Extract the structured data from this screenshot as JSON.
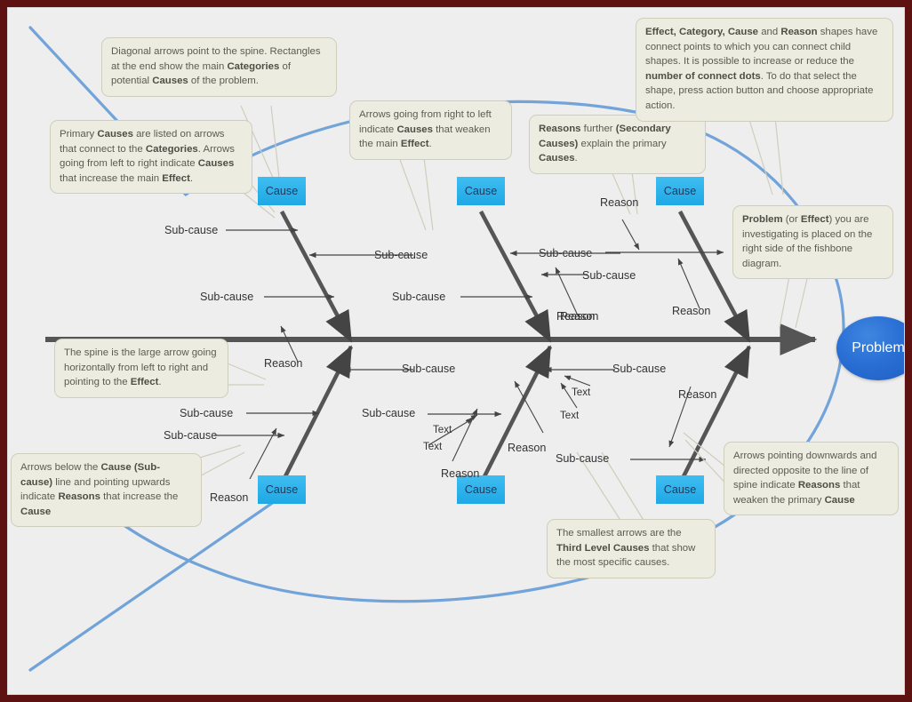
{
  "diagram": {
    "type": "fishbone-ishikawa",
    "problem_label": "Problem",
    "category_label": "Cause",
    "categories": [
      {
        "id": "cat-top-left",
        "label": "Cause"
      },
      {
        "id": "cat-top-middle",
        "label": "Cause"
      },
      {
        "id": "cat-top-right",
        "label": "Cause"
      },
      {
        "id": "cat-bottom-left",
        "label": "Cause"
      },
      {
        "id": "cat-bottom-middle",
        "label": "Cause"
      },
      {
        "id": "cat-bottom-right",
        "label": "Cause"
      }
    ],
    "labels": [
      {
        "id": "l1",
        "text": "Sub-cause"
      },
      {
        "id": "l2",
        "text": "Sub-cause"
      },
      {
        "id": "l3",
        "text": "Sub-cause"
      },
      {
        "id": "l4",
        "text": "Sub-cause"
      },
      {
        "id": "l5",
        "text": "Reason"
      },
      {
        "id": "l6",
        "text": "Sub-cause"
      },
      {
        "id": "l7",
        "text": "Sub-cause"
      },
      {
        "id": "l8",
        "text": "Reason"
      },
      {
        "id": "l9",
        "text": "Sub-cause"
      },
      {
        "id": "l10",
        "text": "Reason"
      },
      {
        "id": "l11",
        "text": "Reason"
      },
      {
        "id": "l12",
        "text": "Sub-cause"
      },
      {
        "id": "l13",
        "text": "Sub-cause"
      },
      {
        "id": "l14",
        "text": "Sub-cause"
      },
      {
        "id": "l15",
        "text": "Sub-cause"
      },
      {
        "id": "l16",
        "text": "Reason"
      },
      {
        "id": "l17",
        "text": "Text"
      },
      {
        "id": "l18",
        "text": "Text"
      },
      {
        "id": "l19",
        "text": "Text"
      },
      {
        "id": "l20",
        "text": "Text"
      },
      {
        "id": "l21",
        "text": "Reason"
      },
      {
        "id": "l22",
        "text": "Reason"
      },
      {
        "id": "l23",
        "text": "Reason"
      },
      {
        "id": "l24",
        "text": "Reason"
      },
      {
        "id": "l25",
        "text": "Sub-cause"
      },
      {
        "id": "l26",
        "text": "Reason"
      }
    ]
  },
  "notes": {
    "diagonal_arrows": {
      "id": "note-diagonal-arrows",
      "parts": [
        {
          "t": "Diagonal arrows point to the spine. Rectangles at the end show the main "
        },
        {
          "t": "Categories",
          "b": true
        },
        {
          "t": " of potential "
        },
        {
          "t": "Causes",
          "b": true
        },
        {
          "t": " of the problem."
        }
      ]
    },
    "primary_causes": {
      "id": "note-primary-causes",
      "parts": [
        {
          "t": "Primary "
        },
        {
          "t": "Causes",
          "b": true
        },
        {
          "t": " are listed on arrows that connect to the "
        },
        {
          "t": "Categories",
          "b": true
        },
        {
          "t": ". Arrows going from left to right indicate "
        },
        {
          "t": "Causes",
          "b": true
        },
        {
          "t": " that increase the main "
        },
        {
          "t": "Effect",
          "b": true
        },
        {
          "t": "."
        }
      ]
    },
    "right_to_left": {
      "id": "note-right-to-left",
      "parts": [
        {
          "t": "Arrows going from right to left indicate "
        },
        {
          "t": "Causes",
          "b": true
        },
        {
          "t": " that weaken the main "
        },
        {
          "t": "Effect",
          "b": true
        },
        {
          "t": "."
        }
      ]
    },
    "reasons_secondary": {
      "id": "note-reasons-secondary",
      "parts": [
        {
          "t": "Reasons",
          "b": true
        },
        {
          "t": " further "
        },
        {
          "t": "(Secondary Causes)",
          "b": true
        },
        {
          "t": " explain the primary "
        },
        {
          "t": "Causes",
          "b": true
        },
        {
          "t": "."
        }
      ]
    },
    "connect_points": {
      "id": "note-connect-points",
      "parts": [
        {
          "t": "Effect, Category, Cause",
          "b": true
        },
        {
          "t": " and "
        },
        {
          "t": "Reason",
          "b": true
        },
        {
          "t": " shapes have connect points to which you can connect child shapes. It is possible to increase or reduce the "
        },
        {
          "t": "number of connect dots",
          "b": true
        },
        {
          "t": ". To do that select the shape, press action button and choose appropriate action."
        }
      ]
    },
    "problem_effect": {
      "id": "note-problem-effect",
      "parts": [
        {
          "t": "Problem",
          "b": true
        },
        {
          "t": " (or "
        },
        {
          "t": "Effect",
          "b": true
        },
        {
          "t": ") you are investigating is placed on the right side of the fishbone diagram."
        }
      ]
    },
    "spine": {
      "id": "note-spine",
      "parts": [
        {
          "t": "The spine is the large arrow going horizontally from left to right and pointing to the "
        },
        {
          "t": "Effect",
          "b": true
        },
        {
          "t": "."
        }
      ]
    },
    "arrows_below": {
      "id": "note-arrows-below",
      "parts": [
        {
          "t": "Arrows below the "
        },
        {
          "t": "Cause (Sub-cause)",
          "b": true
        },
        {
          "t": " line and pointing upwards indicate "
        },
        {
          "t": "Reasons",
          "b": true
        },
        {
          "t": " that increase the "
        },
        {
          "t": "Cause",
          "b": true
        }
      ]
    },
    "third_level": {
      "id": "note-third-level",
      "parts": [
        {
          "t": "The smallest arrows are the "
        },
        {
          "t": "Third Level Causes",
          "b": true
        },
        {
          "t": " that show the most specific causes."
        }
      ]
    },
    "arrows_downwards": {
      "id": "note-arrows-downwards",
      "parts": [
        {
          "t": " Arrows pointing downwards and directed opposite to the line of spine indicate "
        },
        {
          "t": "Reasons",
          "b": true
        },
        {
          "t": " that weaken the primary "
        },
        {
          "t": "Cause",
          "b": true
        }
      ]
    }
  },
  "colors": {
    "background": "#eeeeee",
    "page_border": "#5d1111",
    "note_fill": "#edece0",
    "note_stroke": "#cfcdbb",
    "category_fill": "#35b4ec",
    "problem_fill": "#2a6fd4",
    "bone_stroke": "#555555",
    "decor_curve": "#6a9fd8"
  }
}
